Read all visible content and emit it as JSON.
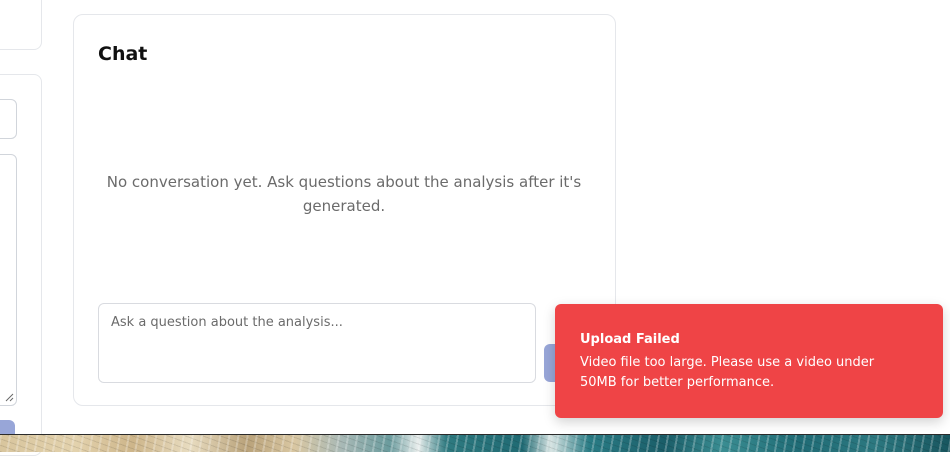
{
  "chat": {
    "title": "Chat",
    "empty_message": "No conversation yet. Ask questions about the analysis after it's generated.",
    "input_placeholder": "Ask a question about the analysis...",
    "input_value": ""
  },
  "toast": {
    "title": "Upload Failed",
    "message": "Video file too large. Please use a video under 50MB for better performance.",
    "color": "#ef4446"
  },
  "colors": {
    "button_disabled": "#98a6d8",
    "border": "#e5e7eb"
  }
}
